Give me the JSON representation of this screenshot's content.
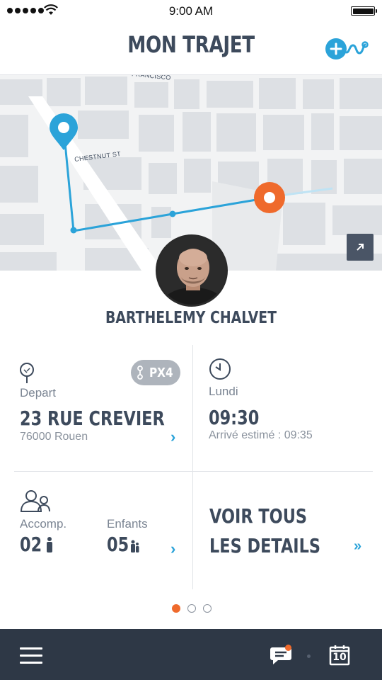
{
  "status_bar": {
    "time": "9:00 AM"
  },
  "header": {
    "title": "MON TRAJET",
    "add_route_icon": "add-route-icon"
  },
  "map": {
    "street_labels": [
      "CHESTNUT ST",
      "FRANCISCO"
    ],
    "route_color": "#2ba3d9",
    "destination_color": "#ef6a2c",
    "expand_icon": "expand-arrow-icon"
  },
  "driver": {
    "name": "BARTHELEMY CHALVET"
  },
  "departure": {
    "label": "Depart",
    "address": "23 RUE CREVIER",
    "city": "76000 Rouen",
    "vehicle_badge": "PX4",
    "icon": "location-tree-icon"
  },
  "schedule": {
    "day": "Lundi",
    "time": "09:30",
    "estimated_arrival": "Arrivé estimé : 09:35",
    "icon": "clock-icon"
  },
  "passengers": {
    "companions_label": "Accomp.",
    "companions_count": "02",
    "children_label": "Enfants",
    "children_count": "05",
    "icon": "people-icon"
  },
  "details": {
    "label": "VOIR TOUS LES DETAILS",
    "chevron": "»"
  },
  "pager": {
    "pages": 3,
    "active": 1
  },
  "bottom_bar": {
    "calendar_day": "10",
    "accent": "#ef6a2c"
  }
}
